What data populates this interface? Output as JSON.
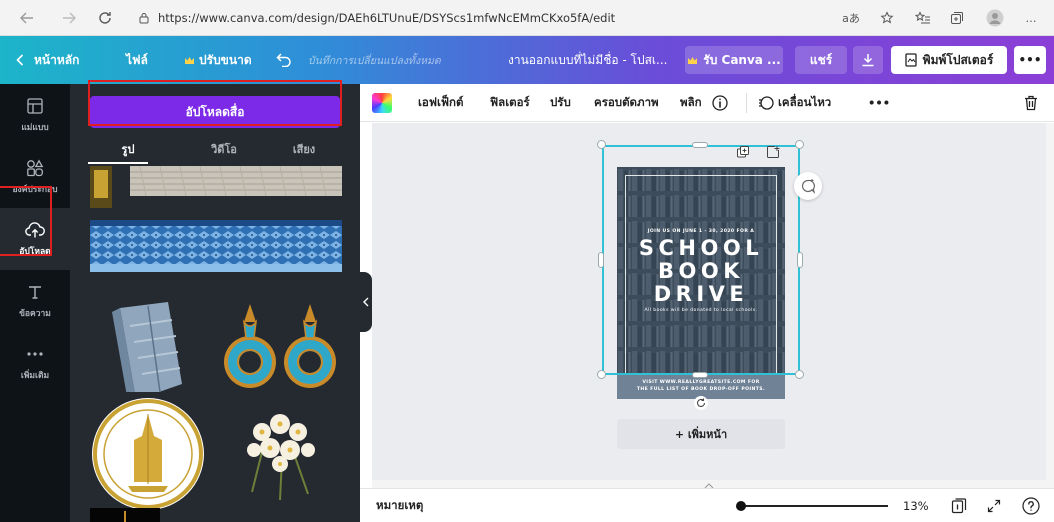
{
  "browser": {
    "url": "https://www.canva.com/design/DAEh6LTUnuE/DSYScs1mfwNcEMmCKxo5fA/edit",
    "read_aloud_label": "aあ",
    "more_label": "…"
  },
  "header": {
    "home_label": "หน้าหลัก",
    "file_label": "ไฟล์",
    "resize_label": "ปรับขนาด",
    "saved_status": "บันทึกการเปลี่ยนแปลงทั้งหมด",
    "design_title": "งานออกแบบที่ไม่มีชื่อ - โปสเ...",
    "get_pro_label": "รับ Canva ...",
    "share_label": "แชร์",
    "print_label": "พิมพ์โปสเตอร์",
    "more_label": "•••"
  },
  "rail": {
    "items": [
      {
        "label": "แม่แบบ",
        "icon": "template-icon"
      },
      {
        "label": "องค์ประกอบ",
        "icon": "elements-icon"
      },
      {
        "label": "อัปโหลด",
        "icon": "upload-cloud-icon"
      },
      {
        "label": "ข้อความ",
        "icon": "text-icon"
      },
      {
        "label": "เพิ่มเติม",
        "icon": "more-dots-icon"
      }
    ]
  },
  "panel": {
    "upload_button": "อัปโหลดสื่อ",
    "tabs": [
      "รูป",
      "วิดีโอ",
      "เสียง"
    ]
  },
  "toolbar": {
    "effects": "เอฟเฟ็กต์",
    "filter": "ฟิลเตอร์",
    "adjust": "ปรับ",
    "crop": "ครอบตัดภาพ",
    "flip": "พลิก",
    "animate": "เคลื่อนไหว",
    "more": "•••"
  },
  "poster": {
    "join_line": "JOIN US ON JUNE 1 - 30, 2020 FOR A",
    "word1": "SCHOOL",
    "word2": "BOOK",
    "word3": "DRIVE",
    "donate_line": "All books will be donated to local schools.",
    "footer_line1": "VISIT WWW.REALLYGREATSITE.COM FOR",
    "footer_line2": "THE FULL LIST OF BOOK DROP-OFF POINTS."
  },
  "canvas": {
    "add_page": "+ เพิ่มหน้า"
  },
  "bottom": {
    "notes_label": "หมายเหตุ",
    "zoom": "13%"
  },
  "colors": {
    "canva_purple": "#7d2ae8",
    "selection": "#30c1d6",
    "highlight": "#e02020",
    "rail_bg": "#0e1318",
    "panel_bg": "#252a31"
  }
}
